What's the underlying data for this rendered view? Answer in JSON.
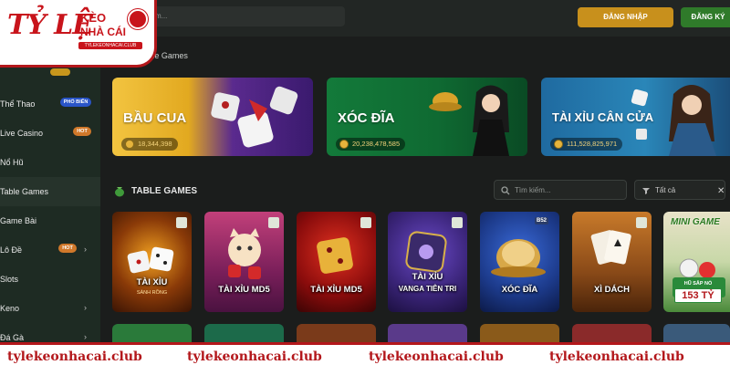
{
  "logo": {
    "main": "TỶ LỆ",
    "keo": "KÈO",
    "nhacai": "NHÀ CÁI",
    "club": "TYLEKEONHACAI.CLUB"
  },
  "header": {
    "search_placeholder": "m...",
    "login_label": "ĐĂNG NHẬP",
    "register_label": "ĐĂNG KÝ"
  },
  "sidebar": {
    "items": [
      {
        "label": "Thể Thao",
        "badge": "PHỔ BIẾN"
      },
      {
        "label": "Live Casino",
        "badge": "HOT"
      },
      {
        "label": "Nổ Hũ"
      },
      {
        "label": "Table Games"
      },
      {
        "label": "Game Bài"
      },
      {
        "label": "Lô Đề",
        "badge": "HOT"
      },
      {
        "label": "Slots"
      },
      {
        "label": "Keno"
      },
      {
        "label": "Đá Gà"
      }
    ]
  },
  "breadcrumb": {
    "current": "› Table Games",
    "parent": "ủ"
  },
  "banners": [
    {
      "title": "BẦU CUA",
      "jackpot": "18,344,398"
    },
    {
      "title": "XÓC ĐĨA",
      "jackpot": "20,238,478,585"
    },
    {
      "title": "TÀI XỈU CÂN CỬA",
      "jackpot": "111,528,825,971"
    }
  ],
  "section": {
    "title": "TABLE GAMES",
    "search_placeholder": "Tìm kiếm...",
    "filter_label": "Tất cả"
  },
  "games": [
    {
      "label": "TÀI XỈU",
      "sub": "SÀNH RỒNG"
    },
    {
      "label": "TÀI XỈU MD5"
    },
    {
      "label": "TÀI XỈU MD5"
    },
    {
      "label": "TÀI XỈU",
      "label2": "VANGA TIÊN TRI"
    },
    {
      "label": "XÓC ĐĨA",
      "tag": "B52"
    },
    {
      "label": "XÌ DÁCH"
    },
    {
      "label": "MINI GAME",
      "jackpot_label": "HŨ SẮP NỔ",
      "jackpot_value": "153 TỶ"
    }
  ],
  "watermark": "tylekeonhacai.club",
  "colors": {
    "login": "#c8901c",
    "register": "#2f7a2a",
    "sidebar": "#1e2b23",
    "brand_red": "#b3171b"
  }
}
